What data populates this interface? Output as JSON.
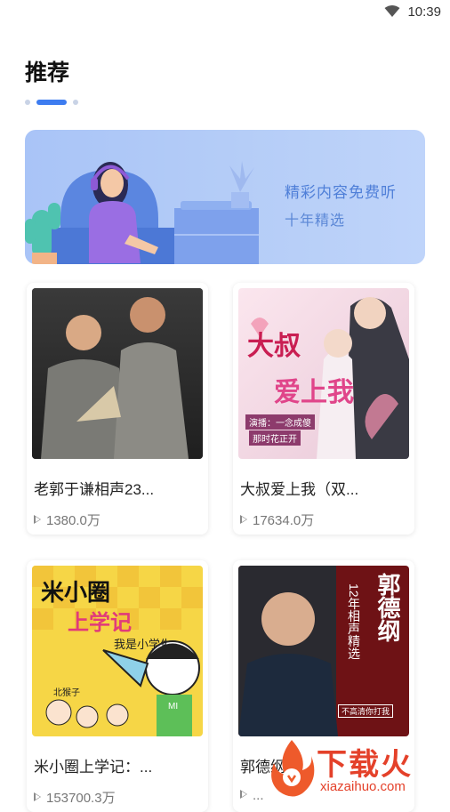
{
  "status_bar": {
    "time": "10:39",
    "icons": [
      "wifi-icon"
    ]
  },
  "header": {
    "title": "推荐"
  },
  "carousel_indicator": {
    "count": 3,
    "active_index": 1,
    "active_color": "#3d7cf0"
  },
  "banner": {
    "line1": "精彩内容免费听",
    "line2": "十年精选",
    "accent": "#4f7fd8"
  },
  "cards": [
    {
      "title": "老郭于谦相声23...",
      "plays": "1380.0万",
      "cover_text": []
    },
    {
      "title": "大叔爱上我（双...",
      "plays": "17634.0万",
      "cover_text": [
        "大叔",
        "爱上我",
        "演播：一念成傻",
        "那时花正开"
      ]
    },
    {
      "title": "米小圈上学记：...",
      "plays": "153700.3万",
      "cover_text": [
        "米小圈",
        "上学记",
        "我是小学生",
        "北猴子",
        "MI"
      ]
    },
    {
      "title": "郭德纲...",
      "plays": "...",
      "cover_text": [
        "郭德纲",
        "12年相声精选",
        "不高清你打我"
      ]
    }
  ],
  "watermark": {
    "brand": "下载火",
    "url": "xiazaihuo.com"
  }
}
